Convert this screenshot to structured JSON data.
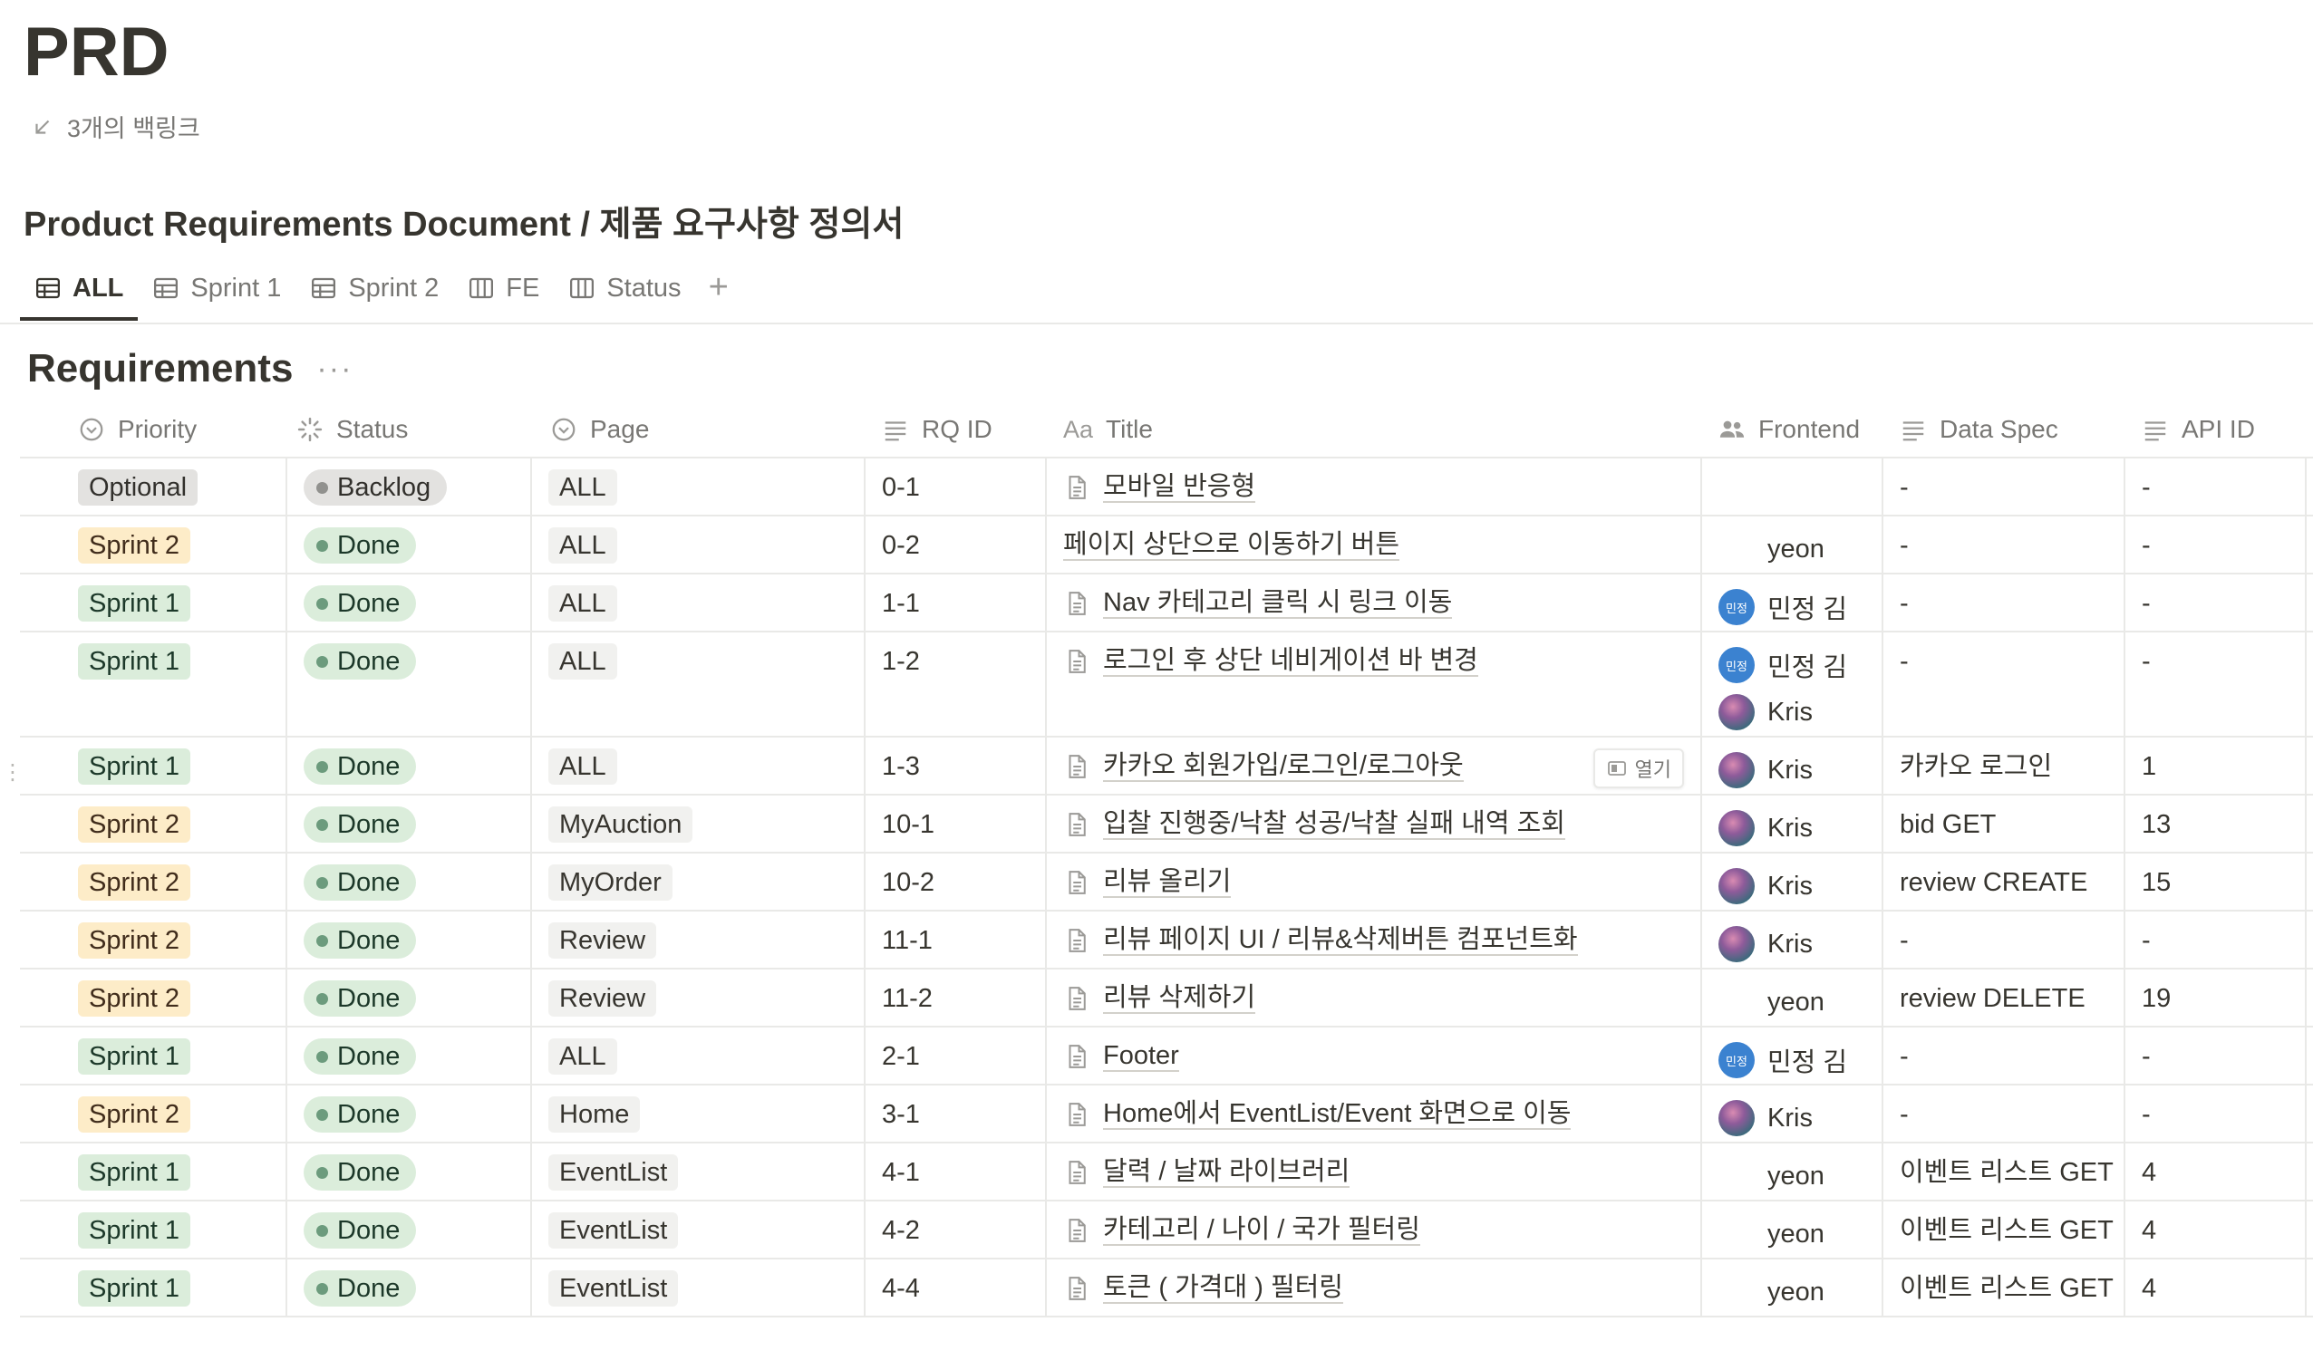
{
  "page": {
    "title": "PRD",
    "backlinks": "3개의 백링크",
    "database_title": "Product Requirements Document / 제품 요구사항 정의서",
    "section_title": "Requirements",
    "more_label": "···"
  },
  "tabs": [
    {
      "label": "ALL",
      "icon": "table-icon",
      "active": true
    },
    {
      "label": "Sprint 1",
      "icon": "table-icon",
      "active": false
    },
    {
      "label": "Sprint 2",
      "icon": "table-icon",
      "active": false
    },
    {
      "label": "FE",
      "icon": "board-icon",
      "active": false
    },
    {
      "label": "Status",
      "icon": "board-icon",
      "active": false
    }
  ],
  "tab_add": "+",
  "columns": {
    "priority": "Priority",
    "status": "Status",
    "page": "Page",
    "rq_id": "RQ ID",
    "title_prefix": "Aa",
    "title": "Title",
    "frontend": "Frontend",
    "data_spec": "Data Spec",
    "api_id": "API ID"
  },
  "open_button": "열기",
  "colors": {
    "sprint1_bg": "#dbeddb",
    "sprint2_bg": "#fdecc8",
    "optional_bg": "#e3e2e0",
    "done_dot": "#6c9b7d",
    "backlog_dot": "#91918e",
    "avatar_blue": "#3b82d0"
  },
  "rows": [
    {
      "priority": "Optional",
      "priority_color": "gray",
      "status": "Backlog",
      "status_kind": "backlog",
      "page": "ALL",
      "rq_id": "0-1",
      "title": "모바일 반응형",
      "has_doc_icon": true,
      "frontend": [],
      "data_spec": "-",
      "api_id": "-"
    },
    {
      "priority": "Sprint 2",
      "priority_color": "yellow",
      "status": "Done",
      "status_kind": "done",
      "page": "ALL",
      "rq_id": "0-2",
      "title": "페이지 상단으로 이동하기 버튼",
      "has_doc_icon": false,
      "frontend": [
        {
          "name": "yeon",
          "avatar": "devil"
        }
      ],
      "data_spec": "-",
      "api_id": "-"
    },
    {
      "priority": "Sprint 1",
      "priority_color": "green",
      "status": "Done",
      "status_kind": "done",
      "page": "ALL",
      "rq_id": "1-1",
      "title": "Nav 카테고리 클릭 시 링크 이동",
      "has_doc_icon": true,
      "frontend": [
        {
          "name": "민정 김",
          "avatar": "mj",
          "initials": "민정"
        }
      ],
      "data_spec": "-",
      "api_id": "-"
    },
    {
      "priority": "Sprint 1",
      "priority_color": "green",
      "status": "Done",
      "status_kind": "done",
      "page": "ALL",
      "rq_id": "1-2",
      "title": "로그인 후 상단 네비게이션 바 변경",
      "has_doc_icon": true,
      "frontend": [
        {
          "name": "민정 김",
          "avatar": "mj",
          "initials": "민정"
        },
        {
          "name": "Kris",
          "avatar": "kris"
        }
      ],
      "data_spec": "-",
      "api_id": "-"
    },
    {
      "priority": "Sprint 1",
      "priority_color": "green",
      "status": "Done",
      "status_kind": "done",
      "page": "ALL",
      "rq_id": "1-3",
      "title": "카카오 회원가입/로그인/로그아웃",
      "has_doc_icon": true,
      "hover_open": true,
      "frontend": [
        {
          "name": "Kris",
          "avatar": "kris"
        }
      ],
      "data_spec": "카카오 로그인",
      "api_id": "1"
    },
    {
      "priority": "Sprint 2",
      "priority_color": "yellow",
      "status": "Done",
      "status_kind": "done",
      "page": "MyAuction",
      "rq_id": "10-1",
      "title": "입찰 진행중/낙찰 성공/낙찰 실패 내역 조회",
      "has_doc_icon": true,
      "frontend": [
        {
          "name": "Kris",
          "avatar": "kris"
        }
      ],
      "data_spec": "bid GET",
      "api_id": "13"
    },
    {
      "priority": "Sprint 2",
      "priority_color": "yellow",
      "status": "Done",
      "status_kind": "done",
      "page": "MyOrder",
      "rq_id": "10-2",
      "title": "리뷰 올리기",
      "has_doc_icon": true,
      "frontend": [
        {
          "name": "Kris",
          "avatar": "kris"
        }
      ],
      "data_spec": "review CREATE",
      "api_id": "15"
    },
    {
      "priority": "Sprint 2",
      "priority_color": "yellow",
      "status": "Done",
      "status_kind": "done",
      "page": "Review",
      "rq_id": "11-1",
      "title": "리뷰 페이지 UI / 리뷰&삭제버튼 컴포넌트화",
      "has_doc_icon": true,
      "frontend": [
        {
          "name": "Kris",
          "avatar": "kris"
        }
      ],
      "data_spec": "-",
      "api_id": "-"
    },
    {
      "priority": "Sprint 2",
      "priority_color": "yellow",
      "status": "Done",
      "status_kind": "done",
      "page": "Review",
      "rq_id": "11-2",
      "title": "리뷰 삭제하기",
      "has_doc_icon": true,
      "frontend": [
        {
          "name": "yeon",
          "avatar": "devil"
        }
      ],
      "data_spec": "review DELETE",
      "api_id": "19"
    },
    {
      "priority": "Sprint 1",
      "priority_color": "green",
      "status": "Done",
      "status_kind": "done",
      "page": "ALL",
      "rq_id": "2-1",
      "title": "Footer",
      "has_doc_icon": true,
      "frontend": [
        {
          "name": "민정 김",
          "avatar": "mj",
          "initials": "민정"
        }
      ],
      "data_spec": "-",
      "api_id": "-"
    },
    {
      "priority": "Sprint 2",
      "priority_color": "yellow",
      "status": "Done",
      "status_kind": "done",
      "page": "Home",
      "rq_id": "3-1",
      "title": "Home에서 EventList/Event 화면으로 이동",
      "has_doc_icon": true,
      "frontend": [
        {
          "name": "Kris",
          "avatar": "kris"
        }
      ],
      "data_spec": "-",
      "api_id": "-"
    },
    {
      "priority": "Sprint 1",
      "priority_color": "green",
      "status": "Done",
      "status_kind": "done",
      "page": "EventList",
      "rq_id": "4-1",
      "title": "달력 / 날짜 라이브러리",
      "has_doc_icon": true,
      "frontend": [
        {
          "name": "yeon",
          "avatar": "devil"
        }
      ],
      "data_spec": "이벤트 리스트 GET",
      "api_id": "4"
    },
    {
      "priority": "Sprint 1",
      "priority_color": "green",
      "status": "Done",
      "status_kind": "done",
      "page": "EventList",
      "rq_id": "4-2",
      "title": "카테고리 / 나이 / 국가 필터링",
      "has_doc_icon": true,
      "frontend": [
        {
          "name": "yeon",
          "avatar": "devil"
        }
      ],
      "data_spec": "이벤트 리스트 GET",
      "api_id": "4"
    },
    {
      "priority": "Sprint 1",
      "priority_color": "green",
      "status": "Done",
      "status_kind": "done",
      "page": "EventList",
      "rq_id": "4-4",
      "title": "토큰 ( 가격대 ) 필터링",
      "has_doc_icon": true,
      "frontend": [
        {
          "name": "yeon",
          "avatar": "devil"
        }
      ],
      "data_spec": "이벤트 리스트 GET",
      "api_id": "4"
    }
  ]
}
